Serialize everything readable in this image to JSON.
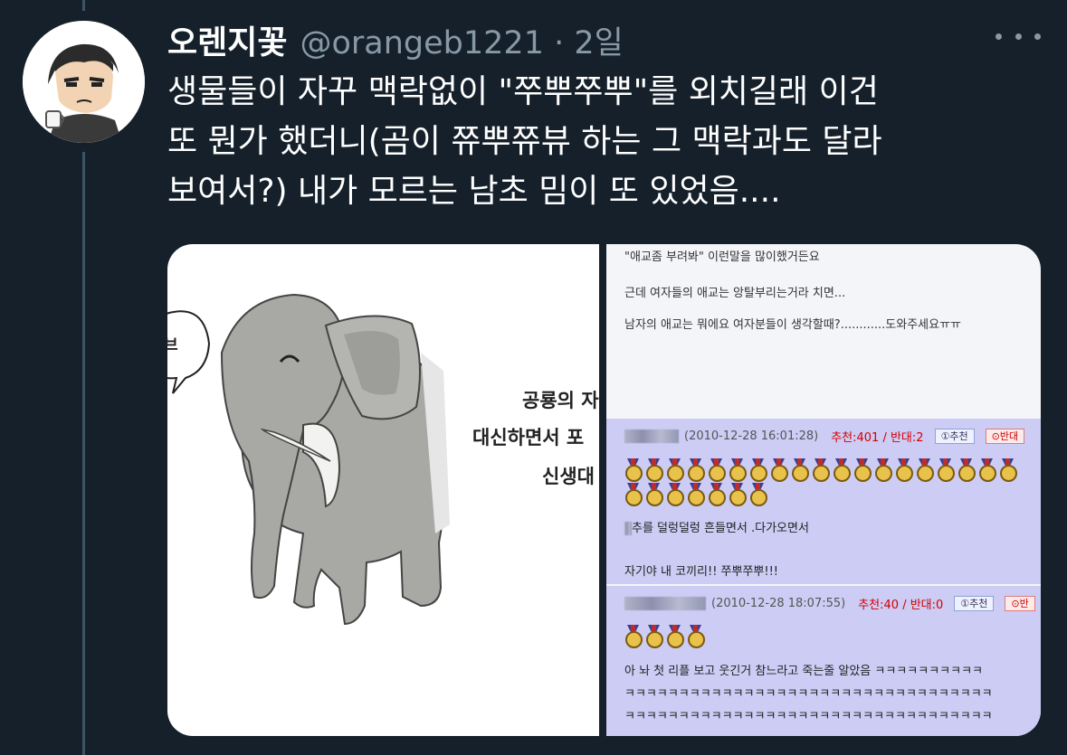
{
  "tweet": {
    "display_name": "오렌지꽃",
    "handle_time": "@orangeb1221 · 2일",
    "text_lines": [
      "생물들이 자꾸 맥락없이 \"쭈뿌쭈뿌\"를 외치길래 이건",
      "또 뭔가 했더니(곰이 쮸뿌쮸뷰 하는 그 맥락과도 달라",
      "보여서?) 내가 모르는 남초 밈이 또 있었음...."
    ],
    "more_icon": "more-horizontal-icon"
  },
  "cartoon": {
    "speech_fragment": "브",
    "caption_lines": [
      "공룡의 자",
      "대신하면서 포",
      "신생대"
    ]
  },
  "forum": {
    "post_lines": [
      "\"애교좀 부려봐\" 이런말을 많이했거든요",
      "근데 여자들의 애교는 앙탈부리는거라 치면...",
      "남자의 애교는 뭐에요 여자분들이 생각할때?............도와주세요ㅠㅠ"
    ],
    "comments": [
      {
        "date": "(2010-12-28 16:01:28)",
        "votes": "추천:401 / 반대:2",
        "up_button": "①추천",
        "down_button": "⊙반대",
        "text_lines": [
          "추를 덜렁덜렁 흔들면서 .다가오면서",
          "자기야 내 코끼리!! 쭈뿌쭈뿌!!!"
        ]
      },
      {
        "date": "(2010-12-28 18:07:55)",
        "votes": "추천:40 / 반대:0",
        "up_button": "①추천",
        "down_button": "⊙반",
        "text_lines": [
          "아 놔 첫 리플 보고 웃긴거 참느라고 죽는줄 알았음 ㅋㅋㅋㅋㅋㅋㅋㅋㅋㅋ",
          "ㅋㅋㅋㅋㅋㅋㅋㅋㅋㅋㅋㅋㅋㅋㅋㅋㅋㅋㅋㅋㅋㅋㅋㅋㅋㅋㅋㅋㅋㅋㅋㅋㅋㅋ",
          "ㅋㅋㅋㅋㅋㅋㅋㅋㅋㅋㅋㅋㅋㅋㅋㅋㅋㅋㅋㅋㅋㅋㅋㅋㅋㅋㅋㅋㅋㅋㅋㅋㅋㅋ"
        ]
      }
    ],
    "medal_counts": [
      26,
      4
    ]
  }
}
